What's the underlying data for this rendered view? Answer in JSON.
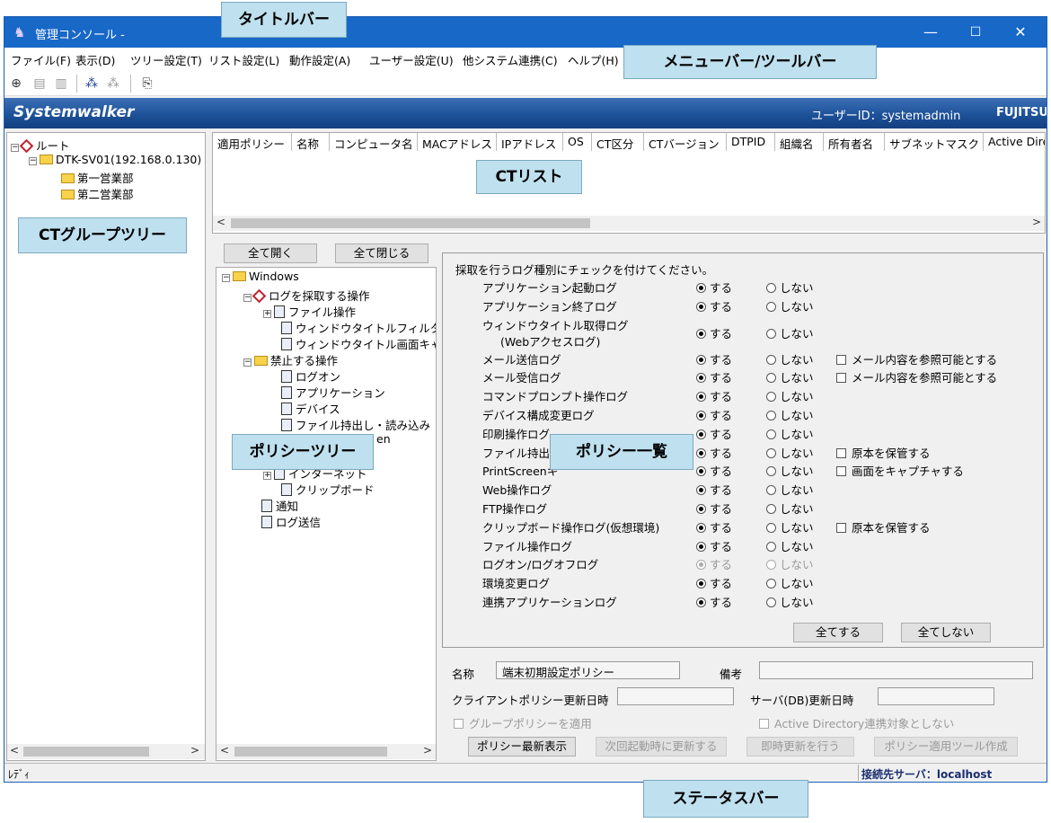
{
  "window": {
    "title": "管理コンソール -",
    "minimize": "—",
    "maximize": "☐",
    "close": "✕"
  },
  "menu": [
    "ファイル(F)",
    "表示(D)",
    "ツリー設定(T)",
    "リスト設定(L)",
    "動作設定(A)",
    "ユーザー設定(U)",
    "他システム連携(C)",
    "ヘルプ(H)"
  ],
  "toolbar_icons": [
    "connect-icon",
    "grid-icon",
    "grid-alt-icon",
    "network-icon",
    "network-disabled-icon",
    "export-icon"
  ],
  "brand": {
    "logo": "Systemwalker",
    "user_id": "ユーザーID：systemadmin",
    "vendor": "FUJITSU"
  },
  "group_tree": {
    "root": "ルート",
    "server": "DTK-SV01(192.168.0.130)",
    "depts": [
      "第一営業部",
      "第二営業部"
    ]
  },
  "ct_list": {
    "columns": [
      "適用ポリシー",
      "名称",
      "コンピュータ名",
      "MACアドレス",
      "IPアドレス",
      "OS",
      "CT区分",
      "CTバージョン",
      "DTPID",
      "組織名",
      "所有者名",
      "サブネットマスク",
      "Active Dire"
    ]
  },
  "policy_tree": {
    "expand_all": "全て開く",
    "collapse_all": "全て閉じる",
    "windows": "Windows",
    "collect": "ログを採取する操作",
    "file_op": "ファイル操作",
    "wt_filter": "ウィンドウタイトルフィルタ",
    "wt_capture": "ウィンドウタイトル画面キャ",
    "forbid": "禁止する操作",
    "logon": "ログオン",
    "app": "アプリケーション",
    "device": "デバイス",
    "file_io": "ファイル持出し・読み込み",
    "print_screen_tail": "en",
    "internet": "インターネット",
    "clipboard": "クリップボード",
    "notify": "通知",
    "log_send": "ログ送信"
  },
  "policy_list": {
    "instruction": "採取を行うログ種別にチェックを付けてください。",
    "yes": "する",
    "no": "しない",
    "items": [
      {
        "label": "アプリケーション起動ログ",
        "value": "yes",
        "option": ""
      },
      {
        "label": "アプリケーション終了ログ",
        "value": "yes",
        "option": ""
      },
      {
        "label": "ウィンドウタイトル取得ログ",
        "sub": "(Webアクセスログ)",
        "value": "yes",
        "option": ""
      },
      {
        "label": "メール送信ログ",
        "value": "yes",
        "option": "メール内容を参照可能とする"
      },
      {
        "label": "メール受信ログ",
        "value": "yes",
        "option": "メール内容を参照可能とする"
      },
      {
        "label": "コマンドプロンプト操作ログ",
        "value": "yes",
        "option": ""
      },
      {
        "label": "デバイス構成変更ログ",
        "value": "yes",
        "option": ""
      },
      {
        "label": "印刷操作ログ",
        "value": "yes",
        "option": ""
      },
      {
        "label": "ファイル持出",
        "value": "yes",
        "option": "原本を保管する"
      },
      {
        "label": "PrintScreenキ",
        "value": "yes",
        "option": "画面をキャプチャする"
      },
      {
        "label": "Web操作ログ",
        "value": "yes",
        "option": ""
      },
      {
        "label": "FTP操作ログ",
        "value": "yes",
        "option": ""
      },
      {
        "label": "クリップボード操作ログ(仮想環境)",
        "value": "yes",
        "option": "原本を保管する"
      },
      {
        "label": "ファイル操作ログ",
        "value": "yes",
        "option": ""
      },
      {
        "label": "ログオン/ログオフログ",
        "value": "yes",
        "option": "",
        "disabled": true
      },
      {
        "label": "環境変更ログ",
        "value": "yes",
        "option": ""
      },
      {
        "label": "連携アプリケーションログ",
        "value": "yes",
        "option": ""
      }
    ],
    "all_on": "全てする",
    "all_off": "全てしない"
  },
  "footer": {
    "name_label": "名称",
    "name_value": "端末初期設定ポリシー",
    "note_label": "備考",
    "client_updated_label": "クライアントポリシー更新日時",
    "server_updated_label": "サーバ(DB)更新日時",
    "group_policy": "グループポリシーを適用",
    "ad_exclude": "Active Directory連携対象としない",
    "btn_refresh": "ポリシー最新表示",
    "btn_next_boot": "次回起動時に更新する",
    "btn_now": "即時更新を行う",
    "btn_tool": "ポリシー適用ツール作成"
  },
  "status": {
    "left": "ﾚﾃﾞｨ",
    "server": "接続先サーバ：localhost"
  },
  "callouts": {
    "titlebar": "タイトルバー",
    "menubar": "メニューバー/ツールバー",
    "ctlist": "CTリスト",
    "grouptree": "CTグループツリー",
    "policytree": "ポリシーツリー",
    "policylist": "ポリシー一覧",
    "statusbar": "ステータスバー"
  }
}
